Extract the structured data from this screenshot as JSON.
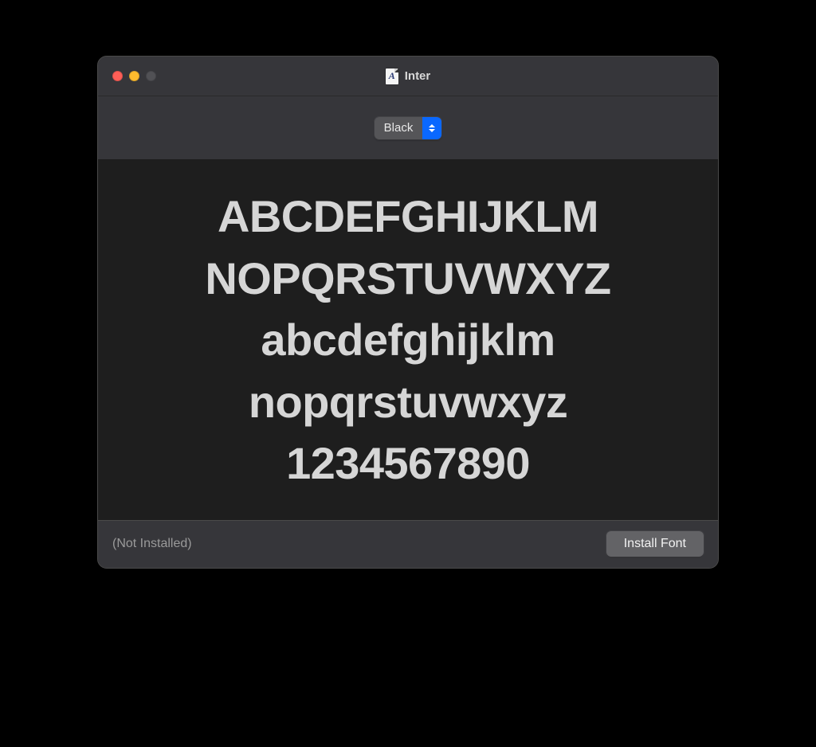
{
  "window": {
    "title": "Inter",
    "doc_icon_glyph": "A"
  },
  "toolbar": {
    "style_selected": "Black"
  },
  "preview": {
    "lines": [
      "ABCDEFGHIJKLM",
      "NOPQRSTUVWXYZ",
      "abcdefghijklm",
      "nopqrstuvwxyz",
      "1234567890"
    ]
  },
  "footer": {
    "status": "(Not Installed)",
    "install_label": "Install Font"
  }
}
